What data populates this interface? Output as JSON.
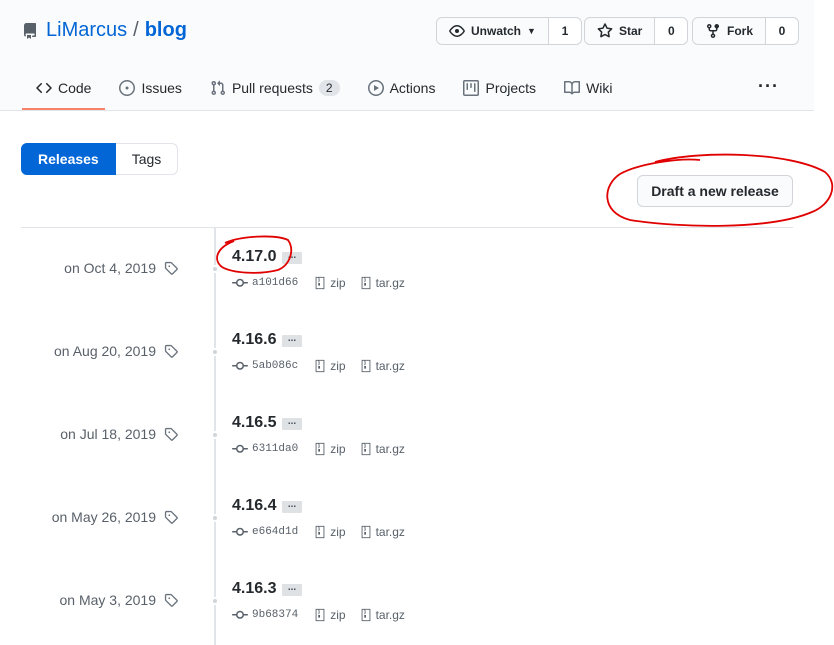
{
  "repo": {
    "owner": "LiMarcus",
    "separator": "/",
    "name": "blog"
  },
  "actions": {
    "watch": {
      "label": "Unwatch",
      "count": "1"
    },
    "star": {
      "label": "Star",
      "count": "0"
    },
    "fork": {
      "label": "Fork",
      "count": "0"
    }
  },
  "tabs": [
    {
      "label": "Code",
      "active": true
    },
    {
      "label": "Issues"
    },
    {
      "label": "Pull requests",
      "count": "2"
    },
    {
      "label": "Actions"
    },
    {
      "label": "Projects"
    },
    {
      "label": "Wiki"
    }
  ],
  "more_label": "···",
  "subnav": {
    "releases": "Releases",
    "tags": "Tags"
  },
  "draft_button": "Draft a new release",
  "releases": [
    {
      "date": "on Oct 4, 2019",
      "version": "4.17.0",
      "ellipsis": "...",
      "sha": "a101d66",
      "zip": "zip",
      "targz": "tar.gz"
    },
    {
      "date": "on Aug 20, 2019",
      "version": "4.16.6",
      "ellipsis": "...",
      "sha": "5ab086c",
      "zip": "zip",
      "targz": "tar.gz"
    },
    {
      "date": "on Jul 18, 2019",
      "version": "4.16.5",
      "ellipsis": "...",
      "sha": "6311da0",
      "zip": "zip",
      "targz": "tar.gz"
    },
    {
      "date": "on May 26, 2019",
      "version": "4.16.4",
      "ellipsis": "...",
      "sha": "e664d1d",
      "zip": "zip",
      "targz": "tar.gz"
    },
    {
      "date": "on May 3, 2019",
      "version": "4.16.3",
      "ellipsis": "...",
      "sha": "9b68374",
      "zip": "zip",
      "targz": "tar.gz"
    }
  ],
  "colors": {
    "accent": "#0366d6",
    "tab_underline": "#f9826c",
    "annotation": "#e00000"
  }
}
